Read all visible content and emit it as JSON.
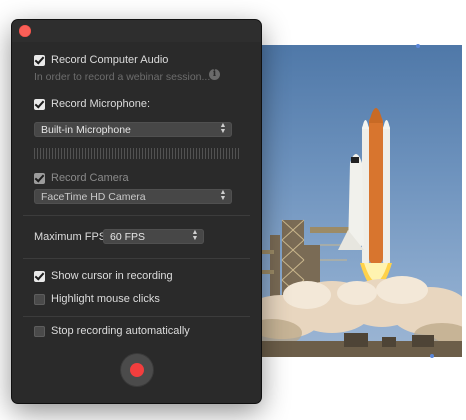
{
  "window": {
    "close_icon": "close-red-circle"
  },
  "audio": {
    "record_computer_audio": {
      "label": "Record Computer Audio",
      "checked": true
    },
    "hint": "In order to record a webinar session...",
    "info_icon": "info-icon"
  },
  "microphone": {
    "record_microphone": {
      "label": "Record Microphone:",
      "checked": true
    },
    "device": "Built-in Microphone"
  },
  "camera": {
    "record_camera": {
      "label": "Record Camera",
      "checked": true,
      "dimmed": true
    },
    "device": "FaceTime HD Camera"
  },
  "fps": {
    "label": "Maximum FPS:",
    "value": "60 FPS"
  },
  "options": {
    "show_cursor": {
      "label": "Show cursor in recording",
      "checked": true
    },
    "highlight_clicks": {
      "label": "Highlight mouse clicks",
      "checked": false
    },
    "stop_auto": {
      "label": "Stop recording automatically",
      "checked": false
    }
  },
  "record_button": {
    "icon": "record-icon",
    "color": "#f23e3e"
  },
  "background_image": {
    "subject": "space shuttle launch"
  }
}
